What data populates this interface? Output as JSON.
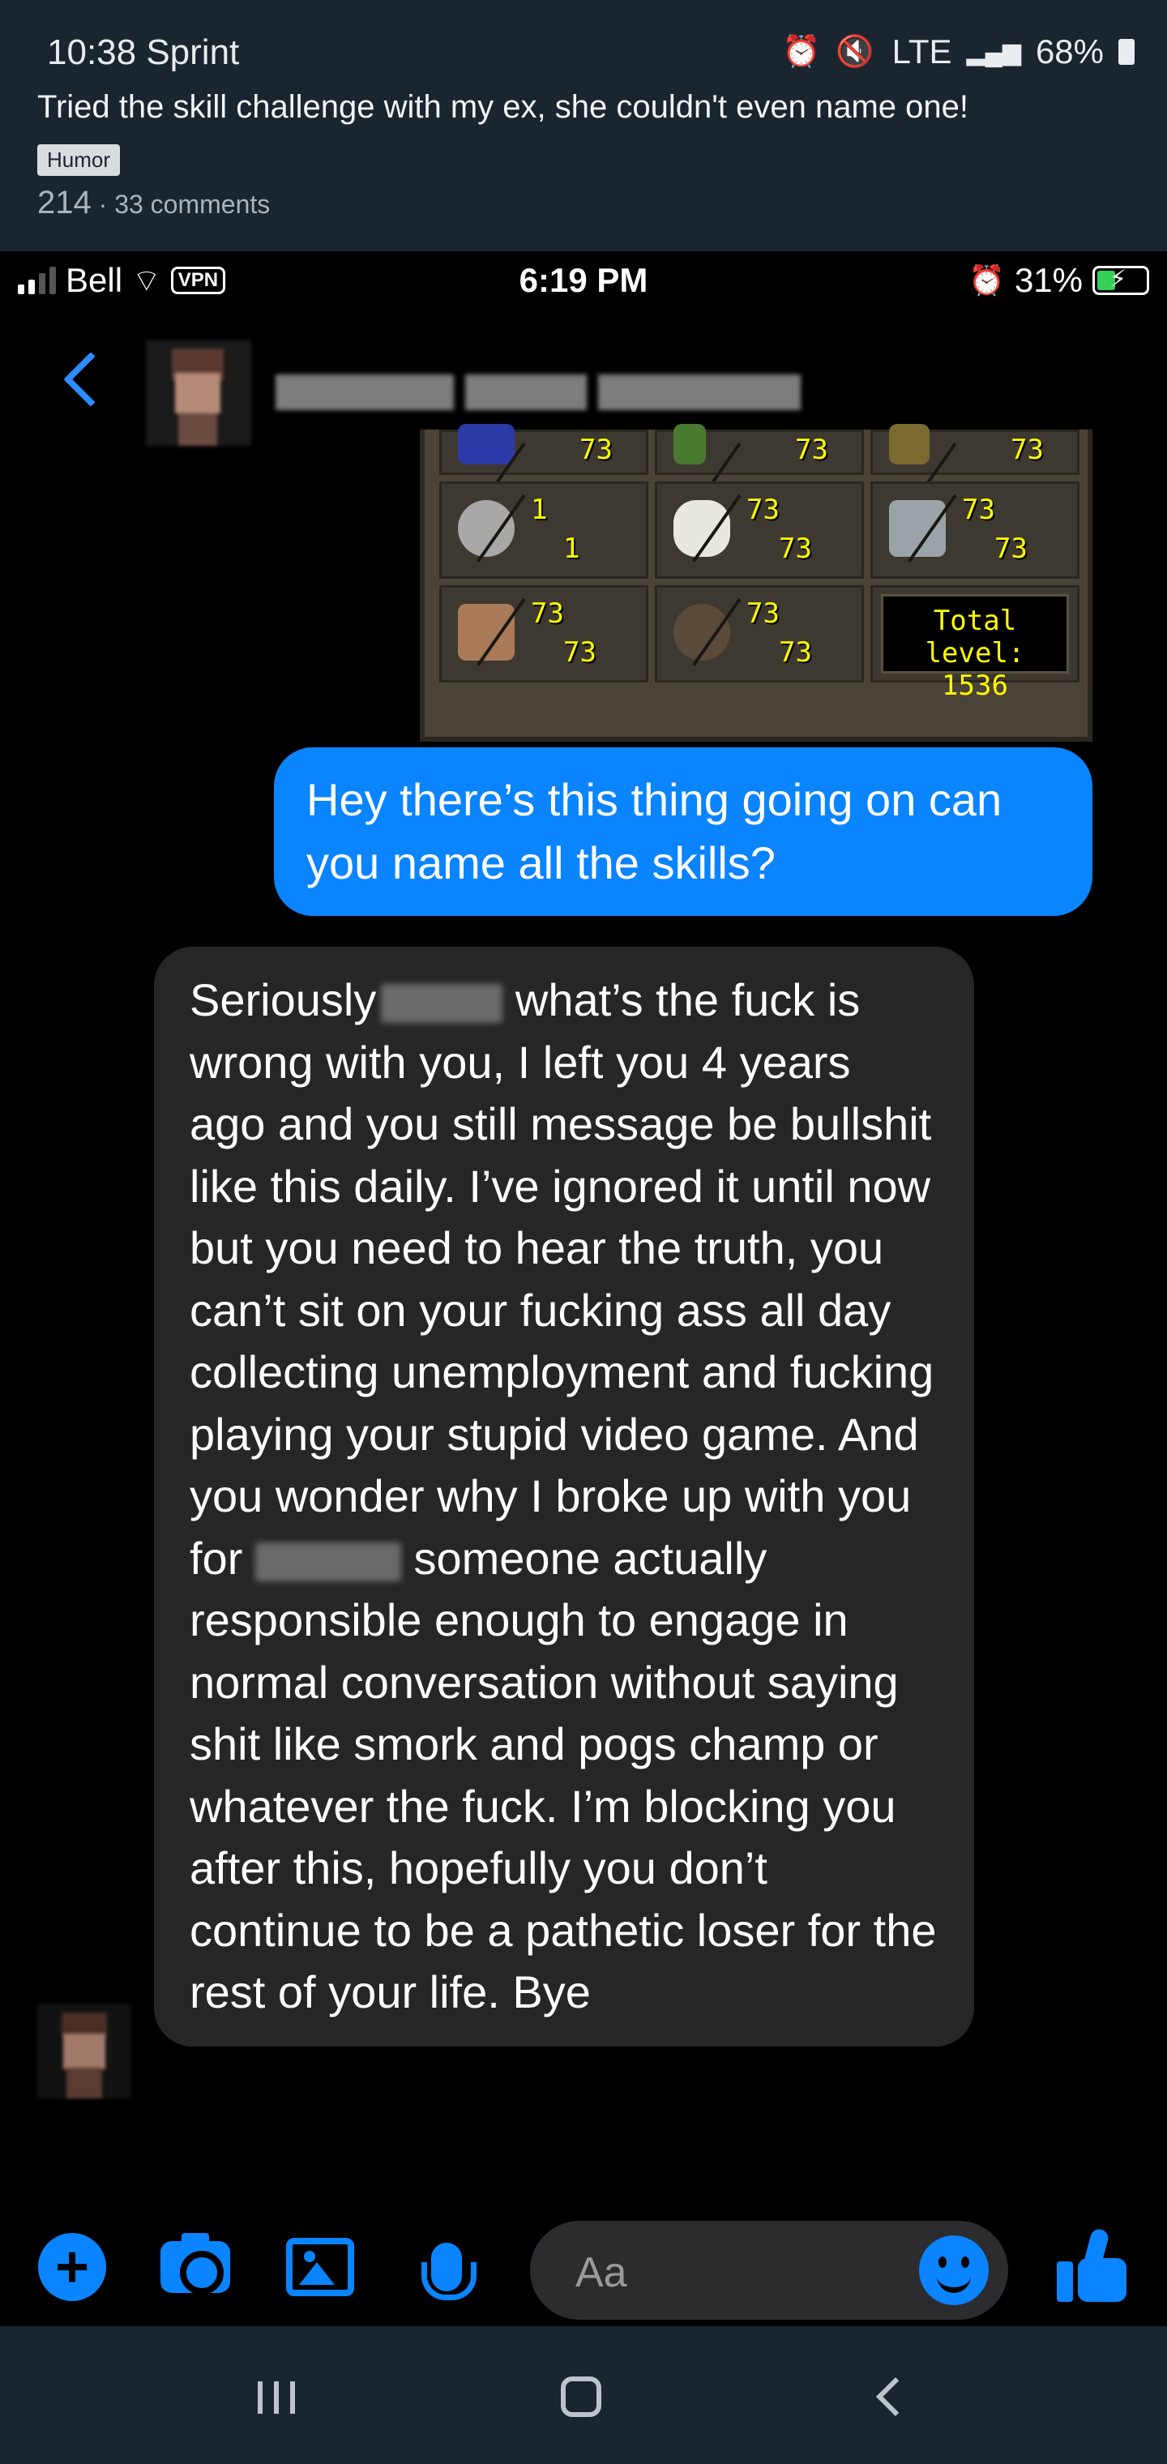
{
  "outer_status": {
    "time_carrier": "10:38 Sprint",
    "network": "LTE",
    "battery": "68%"
  },
  "post": {
    "title": "Tried the skill challenge with my ex, she couldn't even name one!",
    "flair": "Humor",
    "score": "214",
    "separator": " · ",
    "comments": "33 comments"
  },
  "inner_status": {
    "carrier": "Bell",
    "vpn": "VPN",
    "time": "6:19 PM",
    "battery": "31%"
  },
  "skills_panel": {
    "levels": [
      {
        "current": "73",
        "max": "73"
      },
      {
        "current": "73",
        "max": "73"
      },
      {
        "current": "73",
        "max": "73"
      },
      {
        "current": "1",
        "max": "1"
      },
      {
        "current": "73",
        "max": "73"
      },
      {
        "current": "73",
        "max": "73"
      },
      {
        "current": "73",
        "max": "73"
      },
      {
        "current": "73",
        "max": "73"
      }
    ],
    "total_label": "Total level:",
    "total_value": "1536"
  },
  "messages": {
    "outgoing": "Hey there’s this thing going on can you name all the skills?",
    "incoming_part1": "Seriously",
    "incoming_part2": " what’s the fuck is wrong with you, I left you 4 years ago and you still message be bullshit like this daily. I’ve ignored it until now but you need to hear the truth, you can’t sit on your fucking ass all day collecting unemployment and fucking playing your stupid video game. And you wonder why I broke up with you for",
    "incoming_part3": " someone actually responsible enough to engage in normal conversation without saying shit like smork and pogs champ or whatever the fuck. I’m blocking you after this, hopefully you don’t continue to be a pathetic loser for the rest of your life. Bye"
  },
  "composer": {
    "placeholder": "Aa"
  },
  "colors": {
    "accent": "#0a84ff",
    "outer_bg": "#1a2530",
    "incoming_bubble": "#262626",
    "skill_text": "#ffff00"
  }
}
